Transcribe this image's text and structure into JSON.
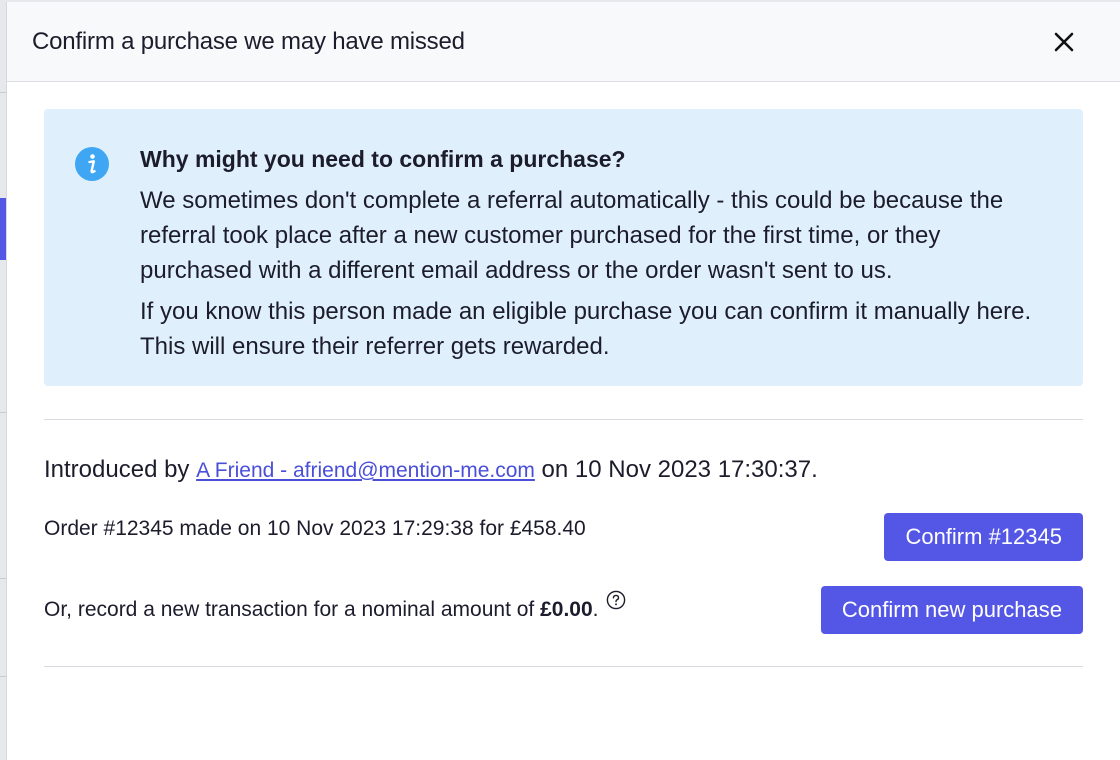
{
  "modal": {
    "title": "Confirm a purchase we may have missed"
  },
  "info": {
    "title": "Why might you need to confirm a purchase?",
    "paragraph1": "We sometimes don't complete a referral automatically - this could be because the referral took place after a new customer purchased for the first time, or they purchased with a different email address or the order wasn't sent to us.",
    "paragraph2": "If you know this person made an eligible purchase you can confirm it manually here. This will ensure their referrer gets rewarded."
  },
  "introduction": {
    "prefix": "Introduced by ",
    "referrer_link": "A Friend - afriend@mention-me.com",
    "suffix": " on 10 Nov 2023 17:30:37."
  },
  "order": {
    "text": "Order #12345 made on 10 Nov 2023 17:29:38 for £458.40",
    "confirm_label": "Confirm #12345"
  },
  "new_transaction": {
    "text_prefix": "Or, record a new transaction for a nominal amount of ",
    "amount": "£0.00",
    "text_suffix": ".",
    "confirm_label": "Confirm new purchase"
  },
  "colors": {
    "accent": "#5457e6",
    "info_background": "#dff0fc",
    "info_icon": "#3ea6f2",
    "link": "#4a4fd8"
  },
  "icons": {
    "close": "close-icon",
    "info": "info-icon",
    "help": "help-circle-icon"
  }
}
